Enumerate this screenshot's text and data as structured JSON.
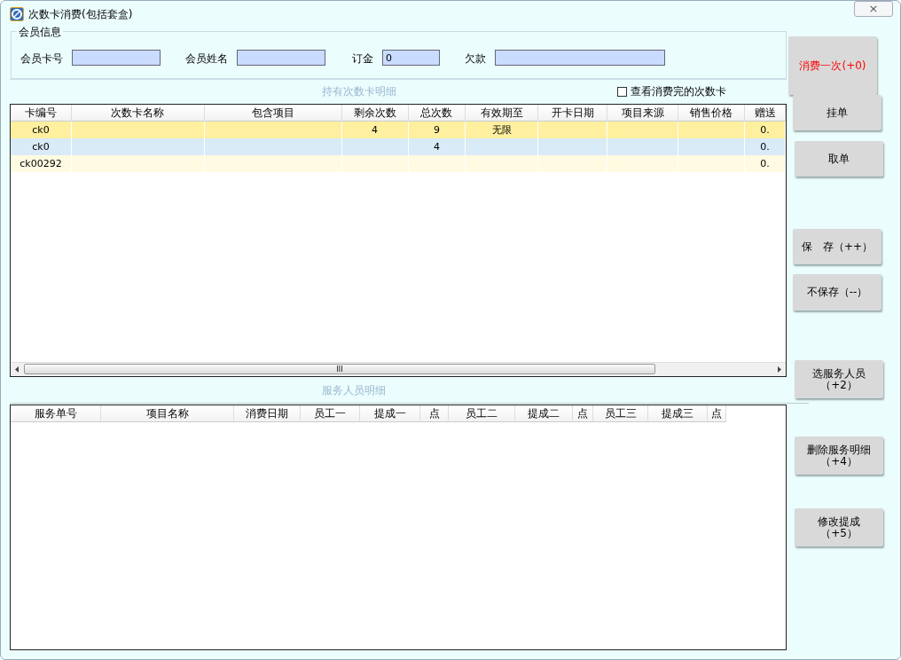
{
  "window": {
    "title": "次数卡消费(包括套盒)",
    "close": "×"
  },
  "member": {
    "legend": "会员信息",
    "fields": [
      {
        "label": "会员卡号"
      },
      {
        "label": "会员姓名"
      },
      {
        "label": "订金",
        "value": "0"
      },
      {
        "label": "欠款"
      }
    ]
  },
  "cards": {
    "title": "持有次数卡明细",
    "show_used": {
      "label": "查看消费完的次数卡",
      "checked": false
    },
    "columns": [
      "卡编号",
      "次数卡名称",
      "包含项目",
      "剩余次数",
      "总次数",
      "有效期至",
      "开卡日期",
      "项目来源",
      "销售价格",
      "赠送"
    ],
    "rows": [
      {
        "selected": true,
        "cells": [
          "ck0",
          "",
          "",
          "4",
          "9",
          "无限",
          "",
          "",
          "",
          "0."
        ]
      },
      {
        "selected": false,
        "cells": [
          "ck0",
          "",
          "",
          "",
          "4",
          "",
          "",
          "",
          "",
          "0."
        ]
      },
      {
        "selected": false,
        "cells": [
          "ck00292",
          "",
          "",
          "",
          "",
          "",
          "",
          "",
          "",
          "0."
        ]
      }
    ],
    "scrollbar_grip": "III"
  },
  "staff": {
    "title": "服务人员明细",
    "columns": [
      "服务单号",
      "项目名称",
      "消费日期",
      "员工一",
      "提成一",
      "点",
      "员工二",
      "提成二",
      "点",
      "员工三",
      "提成三",
      "点"
    ]
  },
  "buttons": [
    {
      "label": "消费一次(+0)",
      "kind": "primary"
    },
    {
      "label": "挂单",
      "kind": "normal"
    },
    {
      "label": "取单",
      "kind": "normal"
    },
    {
      "label": "保　存（++）",
      "kind": "normal"
    },
    {
      "label": "不保存（--）",
      "kind": "normal"
    },
    {
      "label": "选服务人员（+2）",
      "kind": "wrapped"
    },
    {
      "label": "删除服务明细（+4）",
      "kind": "wrapped"
    },
    {
      "label": "修改提成（+5）",
      "kind": "wrapped"
    }
  ]
}
